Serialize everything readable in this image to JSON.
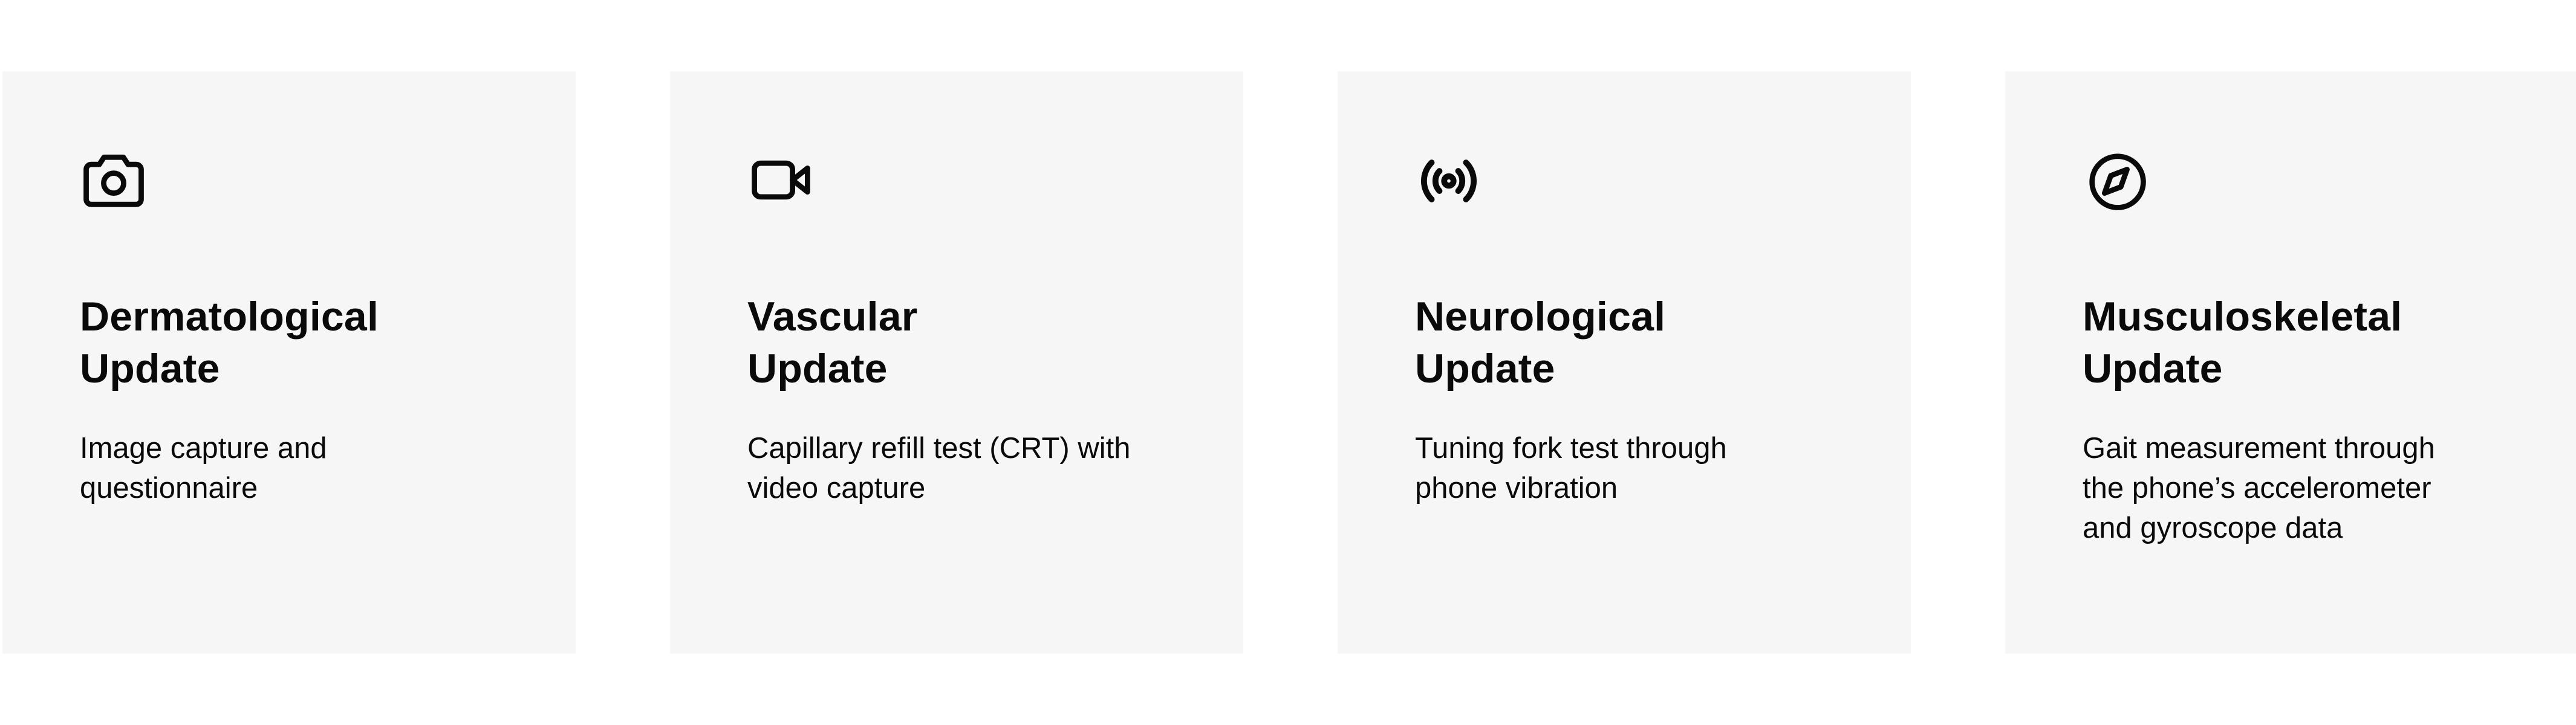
{
  "cards": [
    {
      "icon": "camera-icon",
      "title": "Dermatological\nUpdate",
      "description": "Image capture and\nquestionnaire"
    },
    {
      "icon": "video-icon",
      "title": "Vascular\nUpdate",
      "description": "Capillary refill test (CRT) with\nvideo capture"
    },
    {
      "icon": "broadcast-icon",
      "title": "Neurological\nUpdate",
      "description": "Tuning fork test through\nphone vibration"
    },
    {
      "icon": "compass-icon",
      "title": "Musculoskeletal\nUpdate",
      "description": "Gait measurement through\nthe phone’s accelerometer\nand gyroscope data"
    }
  ],
  "colors": {
    "card_background": "#f6f6f6",
    "text": "#0a0a0a",
    "page_background": "#ffffff"
  }
}
